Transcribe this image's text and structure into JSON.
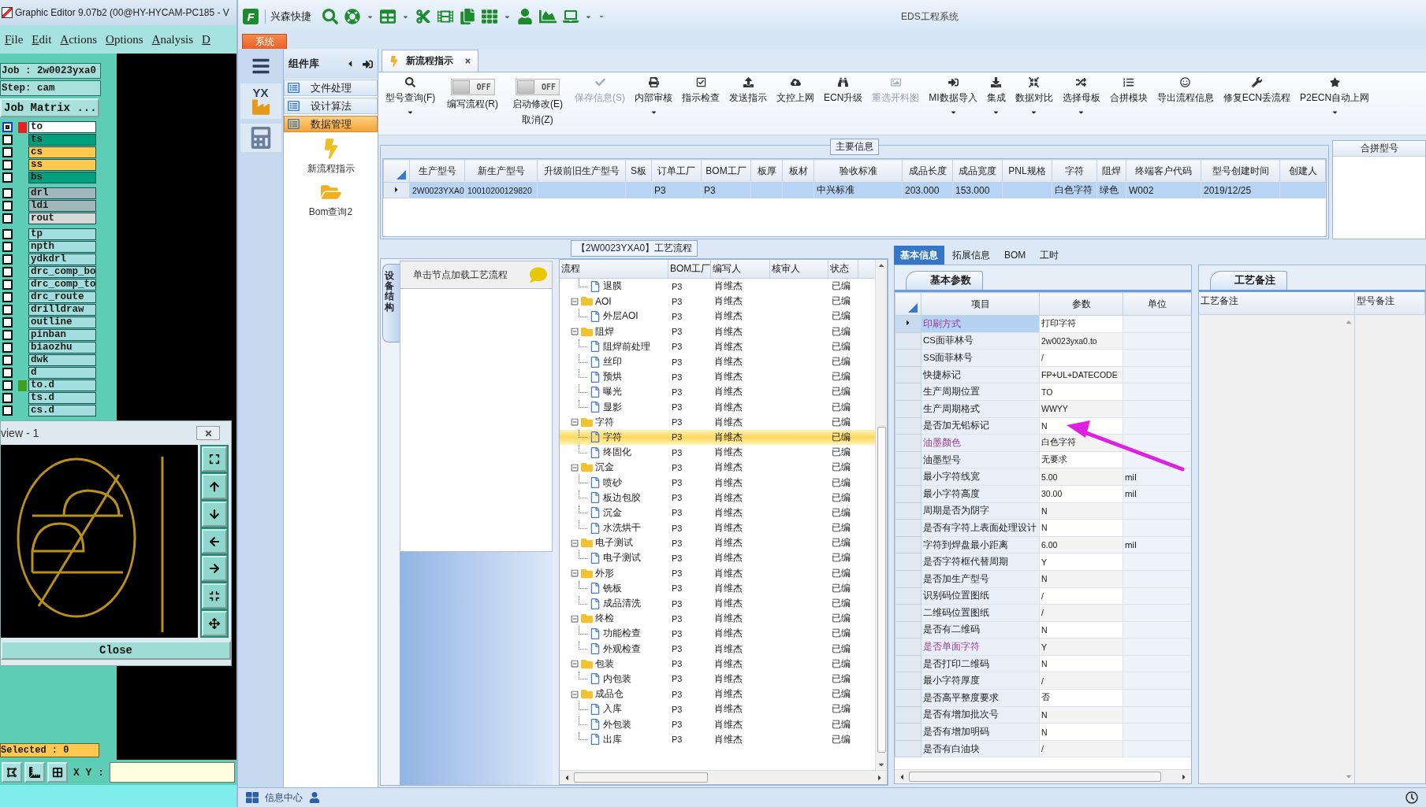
{
  "editor": {
    "title": "Graphic Editor 9.07b2 (00@HY-HYCAM-PC185 - V",
    "menu": [
      "File",
      "Edit",
      "Actions",
      "Options",
      "Analysis",
      "D"
    ],
    "job": "Job : 2w0023yxa0",
    "step": "Step: cam",
    "job_matrix": "Job Matrix ...",
    "layer_groups": [
      [
        {
          "name": "to",
          "color": "#ffffff",
          "marker": {
            "color": "#e82020"
          },
          "selected": true
        },
        {
          "name": "ts",
          "color": "#00a07c",
          "selected": false
        },
        {
          "name": "cs",
          "color": "#ffc84f",
          "selected": false
        },
        {
          "name": "ss",
          "color": "#ffc84f",
          "selected": false
        },
        {
          "name": "bs",
          "color": "#00a07c",
          "selected": false
        }
      ],
      [
        {
          "name": "drl",
          "color": "#a0b8bc",
          "selected": false
        },
        {
          "name": "ldi",
          "color": "#a0b8bc",
          "selected": false
        },
        {
          "name": "rout",
          "color": "#d8d8d8",
          "selected": false
        }
      ],
      [
        {
          "name": "tp",
          "color": "#a3dede",
          "selected": false
        },
        {
          "name": "npth",
          "color": "#a3dede",
          "selected": false
        },
        {
          "name": "ydkdrl",
          "color": "#a3dede",
          "selected": false
        },
        {
          "name": "drc_comp_bo",
          "color": "#a3dede",
          "selected": false
        },
        {
          "name": "drc_comp_to",
          "color": "#a3dede",
          "selected": false
        },
        {
          "name": "drc_route",
          "color": "#a3dede",
          "selected": false
        },
        {
          "name": "drilldraw",
          "color": "#a3dede",
          "selected": false
        },
        {
          "name": "outline",
          "color": "#a3dede",
          "selected": false
        },
        {
          "name": "pinban",
          "color": "#a3dede",
          "selected": false
        },
        {
          "name": "biaozhu",
          "color": "#a3dede",
          "selected": false
        },
        {
          "name": "dwk",
          "color": "#a3dede",
          "selected": false
        },
        {
          "name": "d",
          "color": "#a3dede",
          "selected": false
        },
        {
          "name": "to.d",
          "color": "#a3dede",
          "marker": {
            "color": "#40a020"
          },
          "selected": false
        },
        {
          "name": "ts.d",
          "color": "#a3dede",
          "selected": false
        },
        {
          "name": "cs.d",
          "color": "#a3dede",
          "selected": false
        }
      ]
    ],
    "preview": {
      "title": "view - 1",
      "close": "Close"
    },
    "selected": "Selected : 0",
    "xy_label": "X Y :"
  },
  "app": {
    "logo": "F",
    "quick_label": "兴森快捷",
    "title": "EDS工程系统",
    "system_tab": "系统",
    "rail_badge": "YX",
    "library": {
      "title": "组件库",
      "items": [
        {
          "label": "文件处理",
          "selected": false
        },
        {
          "label": "设计算法",
          "selected": false
        },
        {
          "label": "数据管理",
          "selected": true
        }
      ],
      "tools": [
        "新流程指示",
        "Bom查询2"
      ]
    },
    "doc_tab": "新流程指示",
    "ribbon": [
      {
        "kind": "button",
        "label": "型号查询(F)",
        "dropdown": true,
        "disabled": false
      },
      {
        "kind": "toggle",
        "switch_text": "OFF",
        "on": false,
        "label": "编写流程(R)"
      },
      {
        "kind": "toggle",
        "switch_text": "OFF",
        "on": false,
        "label": "启动修改(E)",
        "sublabel": "取消(Z)"
      },
      {
        "kind": "button",
        "label": "保存信息(S)",
        "dropdown": false,
        "disabled": true
      },
      {
        "kind": "button",
        "label": "内部审核",
        "dropdown": true,
        "disabled": false
      },
      {
        "kind": "button",
        "label": "指示检查",
        "dropdown": false,
        "disabled": false
      },
      {
        "kind": "button",
        "label": "发送指示",
        "dropdown": false,
        "disabled": false
      },
      {
        "kind": "button",
        "label": "文控上网",
        "dropdown": false,
        "disabled": false
      },
      {
        "kind": "button",
        "label": "ECN升级",
        "dropdown": false,
        "disabled": false
      },
      {
        "kind": "button",
        "label": "重选开料图",
        "dropdown": false,
        "disabled": true
      },
      {
        "kind": "button",
        "label": "MI数据导入",
        "dropdown": true,
        "disabled": false
      },
      {
        "kind": "button",
        "label": "集成",
        "dropdown": true,
        "disabled": false
      },
      {
        "kind": "button",
        "label": "数据对比",
        "dropdown": true,
        "disabled": false
      },
      {
        "kind": "button",
        "label": "选择母板",
        "dropdown": true,
        "disabled": false
      },
      {
        "kind": "button",
        "label": "合拼模块",
        "dropdown": false,
        "disabled": false
      },
      {
        "kind": "button",
        "label": "导出流程信息",
        "dropdown": false,
        "disabled": false
      },
      {
        "kind": "button",
        "label": "修复ECN丢流程",
        "dropdown": false,
        "disabled": false
      },
      {
        "kind": "button",
        "label": "P2ECN自动上网",
        "dropdown": true,
        "disabled": false
      }
    ],
    "main_info": {
      "title": "主要信息",
      "columns": [
        "生产型号",
        "新生产型号",
        "升级前旧生产型号",
        "S板",
        "订单工厂",
        "BOM工厂",
        "板厚",
        "板材",
        "验收标准",
        "成品长度",
        "成品宽度",
        "PNL规格",
        "字符",
        "阻焊",
        "终端客户代码",
        "型号创建时间",
        "创建人"
      ],
      "rows": [
        {
          "selected": true,
          "cells": [
            "2W0023YXA0",
            "10010200129820",
            null,
            null,
            "P3",
            "P3",
            null,
            null,
            "中兴标准",
            "203.000",
            "153.000",
            null,
            "白色字符",
            "绿色",
            "W002",
            "2019/12/25",
            null
          ]
        }
      ],
      "side_title": "合拼型号"
    },
    "flow": {
      "title": "【2W0023YXA0】工艺流程",
      "side_tab": "设备结构",
      "hint": "单击节点加载工艺流程",
      "columns": [
        "流程",
        "BOM工厂",
        "编写人",
        "核审人",
        "状态"
      ],
      "tree": [
        {
          "children": [
            {
              "label": "退膜",
              "bom": "P3",
              "writer": "肖维杰",
              "status": "已编",
              "selected": false
            }
          ]
        },
        {
          "label": "AOI",
          "bom": "P3",
          "writer": "肖维杰",
          "status": "已编",
          "selected": false,
          "expanded": true,
          "children": [
            {
              "label": "外层AOI",
              "bom": "P3",
              "writer": "肖维杰",
              "status": "已编",
              "selected": false
            }
          ]
        },
        {
          "label": "阻焊",
          "bom": "P3",
          "writer": "肖维杰",
          "status": "已编",
          "selected": false,
          "expanded": true,
          "children": [
            {
              "label": "阻焊前处理",
              "bom": "P3",
              "writer": "肖维杰",
              "status": "已编",
              "selected": false
            },
            {
              "label": "丝印",
              "bom": "P3",
              "writer": "肖维杰",
              "status": "已编",
              "selected": false
            },
            {
              "label": "预烘",
              "bom": "P3",
              "writer": "肖维杰",
              "status": "已编",
              "selected": false
            },
            {
              "label": "曝光",
              "bom": "P3",
              "writer": "肖维杰",
              "status": "已编",
              "selected": false
            },
            {
              "label": "显影",
              "bom": "P3",
              "writer": "肖维杰",
              "status": "已编",
              "selected": false
            }
          ]
        },
        {
          "label": "字符",
          "bom": "P3",
          "writer": "肖维杰",
          "status": "已编",
          "selected": false,
          "expanded": true,
          "children": [
            {
              "label": "字符",
              "bom": "P3",
              "writer": "肖维杰",
              "status": "已编",
              "selected": true
            },
            {
              "label": "终固化",
              "bom": "P3",
              "writer": "肖维杰",
              "status": "已编",
              "selected": false
            }
          ]
        },
        {
          "label": "沉金",
          "bom": "P3",
          "writer": "肖维杰",
          "status": "已编",
          "selected": false,
          "expanded": true,
          "children": [
            {
              "label": "喷砂",
              "bom": "P3",
              "writer": "肖维杰",
              "status": "已编",
              "selected": false
            },
            {
              "label": "板边包胶",
              "bom": "P3",
              "writer": "肖维杰",
              "status": "已编",
              "selected": false
            },
            {
              "label": "沉金",
              "bom": "P3",
              "writer": "肖维杰",
              "status": "已编",
              "selected": false
            },
            {
              "label": "水洗烘干",
              "bom": "P3",
              "writer": "肖维杰",
              "status": "已编",
              "selected": false
            }
          ]
        },
        {
          "label": "电子测试",
          "bom": "P3",
          "writer": "肖维杰",
          "status": "已编",
          "selected": false,
          "expanded": true,
          "children": [
            {
              "label": "电子测试",
              "bom": "P3",
              "writer": "肖维杰",
              "status": "已编",
              "selected": false
            }
          ]
        },
        {
          "label": "外形",
          "bom": "P3",
          "writer": "肖维杰",
          "status": "已编",
          "selected": false,
          "expanded": true,
          "children": [
            {
              "label": "铣板",
              "bom": "P3",
              "writer": "肖维杰",
              "status": "已编",
              "selected": false
            },
            {
              "label": "成品清洗",
              "bom": "P3",
              "writer": "肖维杰",
              "status": "已编",
              "selected": false
            }
          ]
        },
        {
          "label": "终检",
          "bom": "P3",
          "writer": "肖维杰",
          "status": "已编",
          "selected": false,
          "expanded": true,
          "children": [
            {
              "label": "功能检查",
              "bom": "P3",
              "writer": "肖维杰",
              "status": "已编",
              "selected": false
            },
            {
              "label": "外观检查",
              "bom": "P3",
              "writer": "肖维杰",
              "status": "已编",
              "selected": false
            }
          ]
        },
        {
          "label": "包装",
          "bom": "P3",
          "writer": "肖维杰",
          "status": "已编",
          "selected": false,
          "expanded": true,
          "children": [
            {
              "label": "内包装",
              "bom": "P3",
              "writer": "肖维杰",
              "status": "已编",
              "selected": false
            }
          ]
        },
        {
          "label": "成品仓",
          "bom": "P3",
          "writer": "肖维杰",
          "status": "已编",
          "selected": false,
          "expanded": true,
          "children": [
            {
              "label": "入库",
              "bom": "P3",
              "writer": "肖维杰",
              "status": "已编",
              "selected": false
            },
            {
              "label": "外包装",
              "bom": "P3",
              "writer": "肖维杰",
              "status": "已编",
              "selected": false
            },
            {
              "label": "出库",
              "bom": "P3",
              "writer": "肖维杰",
              "status": "已编",
              "selected": false
            }
          ]
        }
      ]
    },
    "detail": {
      "tabs": [
        {
          "label": "基本信息",
          "selected": true
        },
        {
          "label": "拓展信息",
          "selected": false
        },
        {
          "label": "BOM",
          "selected": false
        },
        {
          "label": "工时",
          "selected": false
        }
      ],
      "params_title": "基本参数",
      "columns": [
        "项目",
        "参数",
        "单位"
      ],
      "rows": [
        {
          "item": "印刷方式",
          "value": "打印字符",
          "highlighted": true,
          "selected": true
        },
        {
          "item": "CS面菲林号",
          "value": "2w0023yxa0.to",
          "highlighted": false,
          "selected": false
        },
        {
          "item": "SS面菲林号",
          "value": "/",
          "highlighted": false,
          "selected": false
        },
        {
          "item": "快捷标记",
          "value": "FP+UL+DATECODE",
          "highlighted": false,
          "selected": false
        },
        {
          "item": "生产周期位置",
          "value": "TO",
          "highlighted": false,
          "selected": false
        },
        {
          "item": "生产周期格式",
          "value": "WWYY",
          "highlighted": false,
          "selected": false
        },
        {
          "item": "是否加无铅标记",
          "value": "N",
          "highlighted": false,
          "selected": false
        },
        {
          "item": "油墨颜色",
          "value": "白色字符",
          "highlighted": true,
          "selected": false
        },
        {
          "item": "油墨型号",
          "value": "无要求",
          "highlighted": false,
          "selected": false
        },
        {
          "item": "最小字符线宽",
          "value": "5.00",
          "unit": "mil",
          "highlighted": false,
          "selected": false
        },
        {
          "item": "最小字符高度",
          "value": "30.00",
          "unit": "mil",
          "highlighted": false,
          "selected": false
        },
        {
          "item": "周期是否为阴字",
          "value": "N",
          "highlighted": false,
          "selected": false
        },
        {
          "item": "是否有字符上表面处理设计",
          "value": "N",
          "highlighted": false,
          "selected": false
        },
        {
          "item": "字符到焊盘最小距离",
          "value": "6.00",
          "unit": "mil",
          "highlighted": false,
          "selected": false
        },
        {
          "item": "是否字符框代替周期",
          "value": "Y",
          "highlighted": false,
          "selected": false
        },
        {
          "item": "是否加生产型号",
          "value": "N",
          "highlighted": false,
          "selected": false
        },
        {
          "item": "识别码位置图纸",
          "value": "/",
          "highlighted": false,
          "selected": false
        },
        {
          "item": "二维码位置图纸",
          "value": "/",
          "highlighted": false,
          "selected": false
        },
        {
          "item": "是否有二维码",
          "value": "N",
          "highlighted": false,
          "selected": false
        },
        {
          "item": "是否单面字符",
          "value": "Y",
          "highlighted": true,
          "selected": false
        },
        {
          "item": "是否打印二维码",
          "value": "N",
          "highlighted": false,
          "selected": false
        },
        {
          "item": "最小字符厚度",
          "value": "/",
          "highlighted": false,
          "selected": false
        },
        {
          "item": "是否高平整度要求",
          "value": "否",
          "highlighted": false,
          "selected": false
        },
        {
          "item": "是否有增加批次号",
          "value": "N",
          "highlighted": false,
          "selected": false
        },
        {
          "item": "是否有增加明码",
          "value": "N",
          "highlighted": false,
          "selected": false
        },
        {
          "item": "是否有白油块",
          "value": "/",
          "highlighted": false,
          "selected": false
        }
      ],
      "notes_title": "工艺备注",
      "notes_columns": [
        "工艺备注",
        "型号备注"
      ]
    },
    "status_bar": {
      "info": "信息中心"
    }
  }
}
